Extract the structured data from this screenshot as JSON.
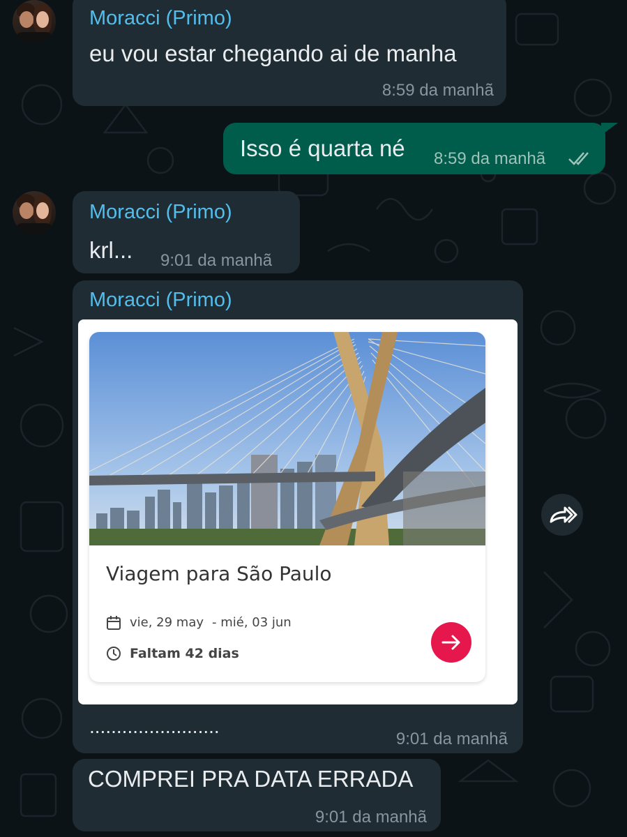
{
  "chat": {
    "messages": [
      {
        "sender": "Moracci (Primo)",
        "text": "eu vou estar chegando ai de manha",
        "time": "8:59 da manhã"
      },
      {
        "text": "Isso é quarta né",
        "time": "8:59 da manhã",
        "status_icon": "double-check-icon"
      },
      {
        "sender": "Moracci (Primo)",
        "text": "krl...",
        "time": "9:01 da manhã"
      },
      {
        "sender": "Moracci (Primo)",
        "card": {
          "title": "Viagem para São Paulo",
          "date_start": "vie, 29 may",
          "date_end": "- mié, 03 jun",
          "countdown": "Faltam 42 dias",
          "calendar_icon": "calendar-icon",
          "clock_icon": "clock-icon",
          "action_icon": "arrow-right-icon",
          "accent_color": "#e5174c"
        },
        "caption": "........................",
        "time": "9:01 da manhã"
      },
      {
        "text": "COMPREI PRA DATA ERRADA",
        "time": "9:01 da manhã"
      }
    ],
    "forward_icon": "forward-icon"
  },
  "colors": {
    "background": "#0c1317",
    "incoming_bubble": "#202c33",
    "outgoing_bubble": "#005c4b",
    "sender_name": "#53bdeb"
  }
}
